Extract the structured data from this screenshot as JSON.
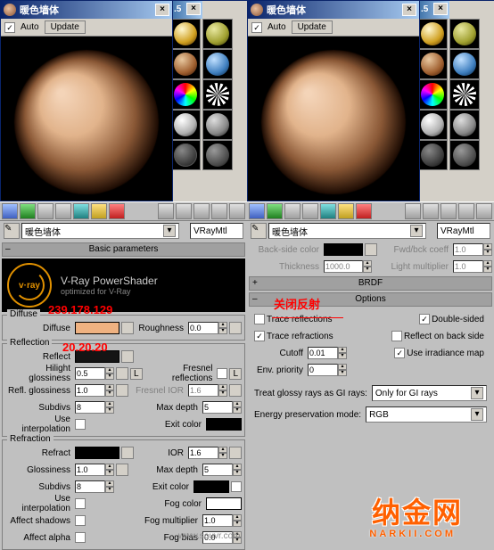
{
  "win_title": "暖色墙体",
  "partial_title": ".5",
  "auto_label": "Auto",
  "update_label": "Update",
  "mat_name": "暖色墙体",
  "mat_type": "VRayMtl",
  "rollouts": {
    "basic": "Basic parameters",
    "brdf": "BRDF",
    "options": "Options"
  },
  "vray": {
    "title": "V-Ray PowerShader",
    "sub": "optimized for V-Ray",
    "logo_txt": "v·ray"
  },
  "overlays": {
    "diffuse_rgb": "239.178.129",
    "reflect_rgb": "20.20.20",
    "close_reflect": "关闭反射"
  },
  "diffuse": {
    "grp": "Diffuse",
    "diffuse_lbl": "Diffuse",
    "diffuse_color": "#efb281",
    "rough_lbl": "Roughness",
    "rough_val": "0.0"
  },
  "reflection": {
    "grp": "Reflection",
    "reflect_lbl": "Reflect",
    "reflect_color": "#141414",
    "hg_lbl": "Hilight glossiness",
    "hg_val": "0.5",
    "rg_lbl": "Refl. glossiness",
    "rg_val": "1.0",
    "subd_lbl": "Subdivs",
    "subd_val": "8",
    "useint_lbl": "Use interpolation",
    "fresnel_lbl": "Fresnel reflections",
    "fior_lbl": "Fresnel IOR",
    "fior_val": "1.6",
    "maxd_lbl": "Max depth",
    "maxd_val": "5",
    "exit_lbl": "Exit color",
    "exit_color": "#000000",
    "l_label": "L"
  },
  "refraction": {
    "grp": "Refraction",
    "refr_lbl": "Refract",
    "refr_color": "#000000",
    "gloss_lbl": "Glossiness",
    "gloss_val": "1.0",
    "subd_lbl": "Subdivs",
    "subd_val": "8",
    "useint_lbl": "Use interpolation",
    "ashad_lbl": "Affect shadows",
    "aalpha_lbl": "Affect alpha",
    "ior_lbl": "IOR",
    "ior_val": "1.6",
    "maxd_lbl": "Max depth",
    "maxd_val": "5",
    "exit_lbl": "Exit color",
    "exit_color": "#000000",
    "fogc_lbl": "Fog color",
    "fogc_color": "#ffffff",
    "fogm_lbl": "Fog multiplier",
    "fogm_val": "1.0",
    "fogb_lbl": "Fog bias",
    "fogb_val": "0.0"
  },
  "opts": {
    "bsc_lbl": "Back-side color",
    "bsc_color": "#000000",
    "thick_lbl": "Thickness",
    "thick_val": "1000.0",
    "fwd_lbl": "Fwd/bck coeff",
    "fwd_val": "1.0",
    "lm_lbl": "Light multiplier",
    "lm_val": "1.0",
    "tr_lbl": "Trace reflections",
    "tf_lbl": "Trace refractions",
    "ds_lbl": "Double-sided",
    "rbs_lbl": "Reflect on back side",
    "irr_lbl": "Use irradiance map",
    "cut_lbl": "Cutoff",
    "cut_val": "0.01",
    "env_lbl": "Env. priority",
    "env_val": "0",
    "gi_lbl": "Treat glossy rays as GI rays:",
    "gi_val": "Only for GI rays",
    "ep_lbl": "Energy preservation mode:",
    "ep_val": "RGB"
  },
  "swatches": [
    {
      "bg": "radial-gradient(circle at 35% 30%,#fff8d0,#d0a020 60%,#402000)"
    },
    {
      "bg": "radial-gradient(circle at 35% 30%,#e8c8a0,#a06030 60%,#301000)"
    },
    {
      "bg": "repeating-conic-gradient(#ff0000 0 30deg,#00ff00 30deg 60deg,#0000ff 60deg 90deg)"
    },
    {
      "bg": "radial-gradient(circle at 35% 30%,#ffffff,#b0b0b0 60%,#202020)"
    },
    {
      "bg": "radial-gradient(circle at 35% 30%,#606060,#303030 60%,#000),repeating-linear-gradient(45deg,#555 0 2px,#222 2px 4px)"
    }
  ],
  "watermark": "纳金网",
  "watermark_sub": "NARKII.COM",
  "watermark2": "www.souvr.com"
}
